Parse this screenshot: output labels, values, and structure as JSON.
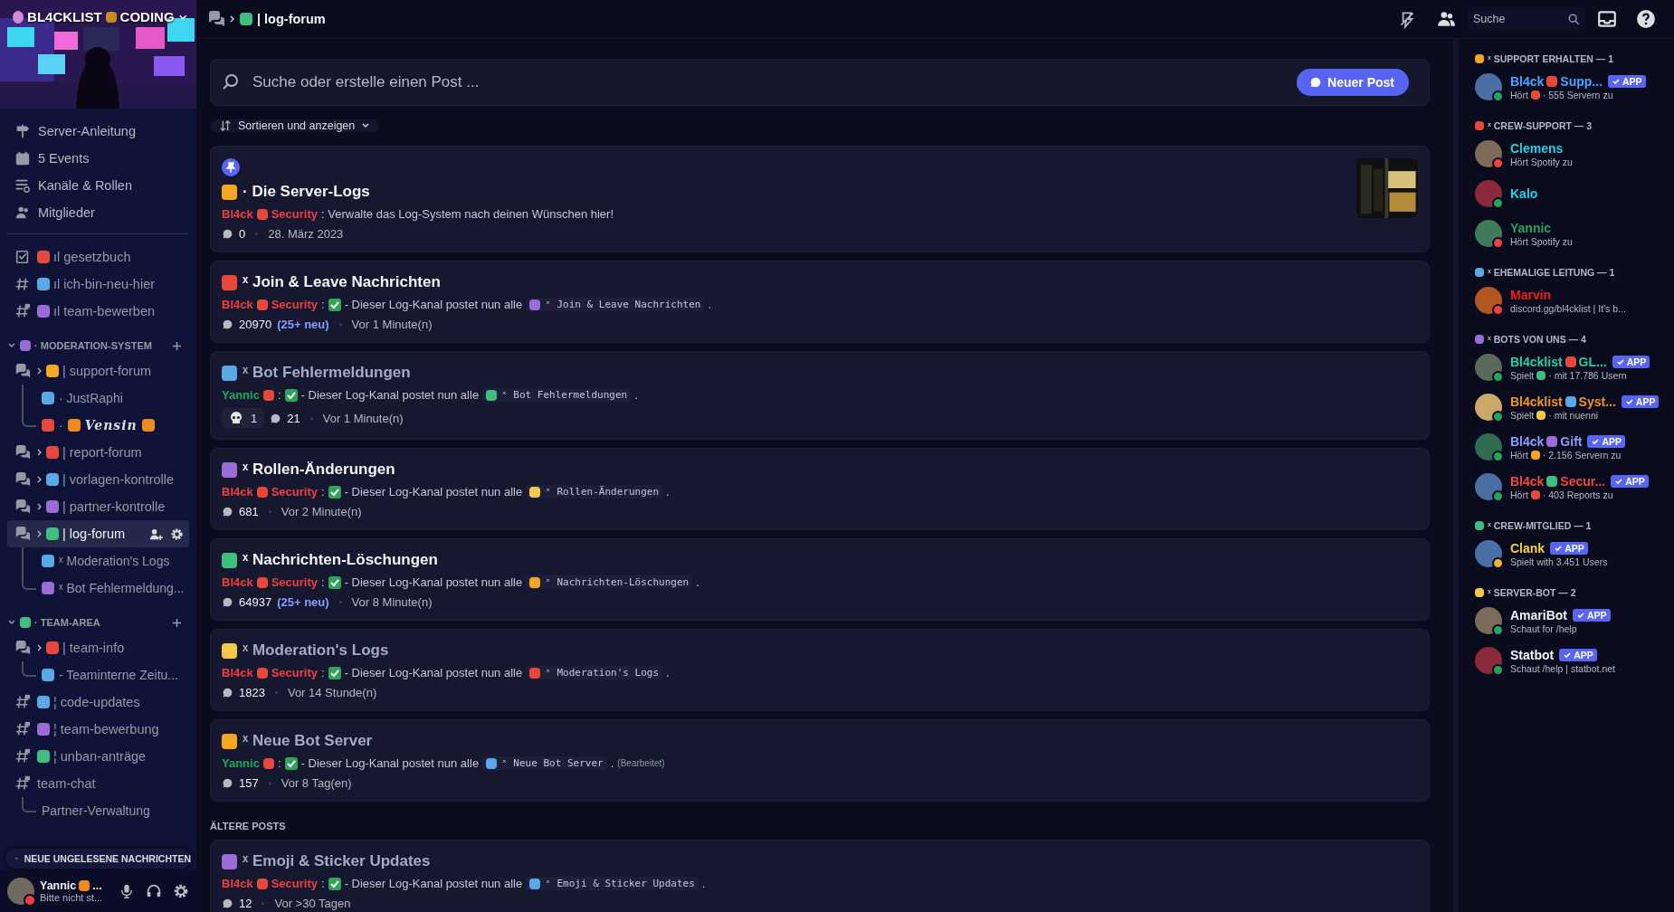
{
  "server": {
    "name": "BL4CKLIST",
    "name_rest": "CODING"
  },
  "nav": [
    {
      "kind": "guide",
      "label": "Server-Anleitung"
    },
    {
      "kind": "events",
      "label": "5 Events"
    },
    {
      "kind": "browse",
      "label": "Kanäle & Rollen"
    },
    {
      "kind": "members",
      "label": "Mitglieder"
    }
  ],
  "channels": [
    {
      "kind": "rules",
      "name": "ıl gesetzbuch",
      "selected": false
    },
    {
      "kind": "text",
      "name": "ıl ich-bin-neu-hier",
      "selected": false
    },
    {
      "kind": "locked",
      "name": "ıl team-bewerben",
      "selected": false
    }
  ],
  "categories": [
    {
      "name": "· MODERATION-SYSTEM",
      "expanded": true,
      "channels": [
        {
          "kind": "forum",
          "name": "| support-forum",
          "selected": false,
          "children": [
            {
              "kind": "plain",
              "name": "· JustRaphi"
            },
            {
              "kind": "fancy",
              "prefix": "·",
              "name": "Vensin"
            }
          ]
        },
        {
          "kind": "forum",
          "name": "| report-forum",
          "selected": false
        },
        {
          "kind": "forum",
          "name": "| vorlagen-kontrolle",
          "selected": false
        },
        {
          "kind": "forum",
          "name": "| partner-kontrolle",
          "selected": false
        },
        {
          "kind": "forum",
          "name": "| log-forum",
          "selected": true,
          "children": [
            {
              "kind": "plain",
              "name": "ˣ Moderation's Logs"
            },
            {
              "kind": "plain",
              "name": "ˣ Bot Fehlermeldung..."
            }
          ]
        }
      ]
    },
    {
      "name": "· TEAM-AREA",
      "expanded": true,
      "channels": [
        {
          "kind": "forum",
          "name": "| team-info",
          "selected": false,
          "children": [
            {
              "kind": "plain",
              "name": "- Teaminterne Zeitu..."
            }
          ]
        },
        {
          "kind": "locked",
          "name": "¦ code-updates",
          "selected": false
        },
        {
          "kind": "locked",
          "name": "¦ team-bewerbung",
          "selected": false
        },
        {
          "kind": "locked",
          "name": "¦ unban-anträge",
          "selected": false
        },
        {
          "kind": "locked-bare",
          "name": "team-chat",
          "selected": false,
          "children": [
            {
              "kind": "bare",
              "name": "Partner-Verwaltung"
            }
          ]
        }
      ]
    }
  ],
  "unread_banner": "NEUE UNGELESENE NACHRICHTEN",
  "user": {
    "name": "Yannic",
    "name_cut": "...",
    "status": "Bitte nicht st...",
    "presence": {
      "color": "#f23f43"
    }
  },
  "header": {
    "channel": "| log-forum",
    "search_placeholder": "Suche"
  },
  "forum": {
    "search_placeholder": "Suche oder erstelle einen Post ...",
    "new_post": "Neuer Post",
    "sort": "Sortieren und anzeigen"
  },
  "posts": [
    {
      "title": "· Die Server-Logs",
      "pinned": true,
      "unread": true,
      "thumbnail": {
        "kind": "picture"
      },
      "author": {
        "name": "Bl4ck",
        "tag": "Security",
        "color": "#f23f43"
      },
      "message": [
        ": Verwalte das Log-System nach deinen Wünschen hier!"
      ],
      "comments": "0",
      "time": "28. März 2023"
    },
    {
      "title": "ˣ Join & Leave Nachrichten",
      "pinned": false,
      "unread": true,
      "author": {
        "name": "Bl4ck",
        "tag": "Security",
        "color": "#f23f43"
      },
      "message": [
        ":",
        "- Dieser Log-Kanal postet nun alle"
      ],
      "chip": "ˣ Join & Leave Nachrichten",
      "end": ".",
      "comments": "20970",
      "new": "(25+ neu)",
      "time": "Vor 1 Minute(n)"
    },
    {
      "title": "ˣ Bot Fehlermeldungen",
      "pinned": false,
      "unread": false,
      "author": {
        "name": "Yannic",
        "color": "#23a55a"
      },
      "message": [
        ":",
        "- Dieser Log-Kanal postet nun alle"
      ],
      "chip": "ˣ Bot Fehlermeldungen",
      "end": ".",
      "reaction": "1",
      "comments": "21",
      "time": "Vor 1 Minute(n)"
    },
    {
      "title": "ˣ Rollen-Änderungen",
      "pinned": false,
      "unread": true,
      "author": {
        "name": "Bl4ck",
        "tag": "Security",
        "color": "#f23f43"
      },
      "message": [
        ":",
        "- Dieser Log-Kanal postet nun alle"
      ],
      "chip": "ˣ Rollen-Änderungen",
      "end": ".",
      "comments": "681",
      "time": "Vor 2 Minute(n)"
    },
    {
      "title": "ˣ Nachrichten-Löschungen",
      "pinned": false,
      "unread": true,
      "author": {
        "name": "Bl4ck",
        "tag": "Security",
        "color": "#f23f43"
      },
      "message": [
        ":",
        "- Dieser Log-Kanal postet nun alle"
      ],
      "chip": "ˣ Nachrichten-Löschungen",
      "end": ".",
      "comments": "64937",
      "new": "(25+ neu)",
      "time": "Vor 8 Minute(n)"
    },
    {
      "title": "ˣ Moderation's Logs",
      "pinned": false,
      "unread": false,
      "author": {
        "name": "Bl4ck",
        "tag": "Security",
        "color": "#f23f43"
      },
      "message": [
        ":",
        "- Dieser Log-Kanal postet nun alle"
      ],
      "chip": "ˣ Moderation's Logs",
      "end": ".",
      "comments": "1823",
      "time": "Vor 14 Stunde(n)"
    },
    {
      "title": "ˣ Neue Bot Server",
      "pinned": false,
      "unread": false,
      "author": {
        "name": "Yannic",
        "color": "#23a55a"
      },
      "message": [
        ":",
        "- Dieser Log-Kanal postet nun alle"
      ],
      "chip": "ˣ Neue Bot Server",
      "end": ".",
      "edited": "(Bearbeitet)",
      "comments": "157",
      "time": "Vor 8 Tag(en)"
    }
  ],
  "older_label": "ÄLTERE POSTS",
  "older_posts": [
    {
      "title": "ˣ Emoji & Sticker Updates",
      "pinned": false,
      "unread": false,
      "author": {
        "name": "Bl4ck",
        "tag": "Security",
        "color": "#f23f43"
      },
      "message": [
        ":",
        "- Dieser Log-Kanal postet nun alle"
      ],
      "chip": "ˣ Emoji & Sticker Updates",
      "end": ".",
      "comments": "12",
      "time": "Vor >30 Tagen"
    }
  ],
  "member_groups": [
    {
      "name": "ˣ SUPPORT ERHALTEN — 1",
      "members": [
        {
          "name": [
            "Bl4ck",
            "Supp..."
          ],
          "color": "#4aa3ff",
          "app": "APP",
          "activity": [
            "Hört",
            "· 555 Servern zu"
          ],
          "presence": {
            "color": "#23a55a"
          }
        }
      ]
    },
    {
      "name": "ˣ CREW-SUPPORT — 3",
      "members": [
        {
          "name": [
            "Clemens"
          ],
          "color": "#22d3e6",
          "activity": [
            "Hört Spotify zu"
          ],
          "presence": {
            "color": "#f23f43"
          }
        },
        {
          "name": [
            "Kalo"
          ],
          "color": "#22d3e6",
          "presence": {
            "color": "#23a55a"
          }
        },
        {
          "name": [
            "Yannic"
          ],
          "color": "#23a55a",
          "activity": [
            "Hört Spotify zu"
          ],
          "presence": {
            "color": "#f23f43"
          }
        }
      ]
    },
    {
      "name": "ˣ EHEMALIGE LEITUNG — 1",
      "members": [
        {
          "name": [
            "Marvin"
          ],
          "color": "#f21c1c",
          "activity": [
            "discord.gg/bl4cklist | It's b..."
          ],
          "presence": {
            "color": "#f23f43"
          }
        }
      ]
    },
    {
      "name": "ˣ BOTS VON UNS — 4",
      "members": [
        {
          "name": [
            "Bl4cklist",
            "GL..."
          ],
          "color": "#1fd1a8",
          "app": "APP",
          "activity": [
            "Spielt",
            "· mit 17.786 Usern"
          ],
          "presence": {
            "color": "#23a55a"
          }
        },
        {
          "name": [
            "Bl4cklist",
            "Syst..."
          ],
          "color": "#f0961e",
          "app": "APP",
          "activity": [
            "Spielt",
            "· mit nuenni"
          ],
          "presence": {
            "color": "#23a55a"
          }
        },
        {
          "name": [
            "Bl4ck",
            "Gift"
          ],
          "color": "#8f9cff",
          "app": "APP",
          "activity": [
            "Hört",
            "· 2.156 Servern zu"
          ],
          "presence": {
            "color": "#23a55a"
          }
        },
        {
          "name": [
            "Bl4ck",
            "Secur..."
          ],
          "color": "#f2473f",
          "app": "APP",
          "activity": [
            "Hört",
            "· 403 Reports zu"
          ],
          "presence": {
            "color": "#23a55a"
          }
        }
      ]
    },
    {
      "name": "ˣ CREW-MITGLIED — 1",
      "members": [
        {
          "name": [
            "Clank"
          ],
          "color": "#f5d142",
          "app": "APP",
          "activity": [
            "Spielt with 3.451 Users"
          ],
          "presence": {
            "color": "#f0b232"
          }
        }
      ]
    },
    {
      "name": "ˣ SERVER-BOT — 2",
      "members": [
        {
          "name": [
            "AmariBot"
          ],
          "color": "#f2f3f5",
          "app": "APP",
          "activity": [
            "Schaut for /help"
          ],
          "presence": {
            "color": "#23a55a"
          }
        },
        {
          "name": [
            "Statbot"
          ],
          "color": "#f2f3f5",
          "app": "APP",
          "activity": [
            "Schaut /help | statbot.net"
          ],
          "presence": {
            "color": "#23a55a"
          }
        }
      ]
    }
  ]
}
